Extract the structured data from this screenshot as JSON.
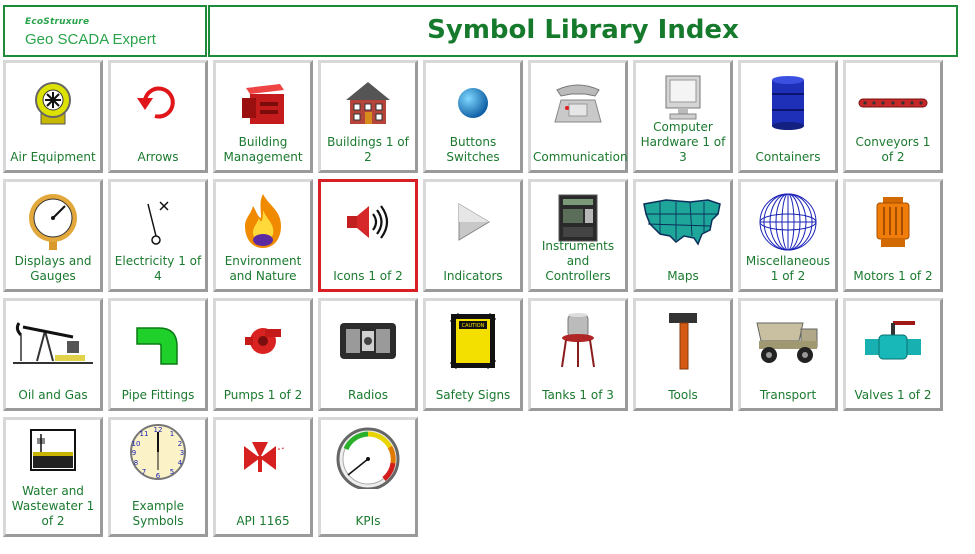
{
  "header": {
    "brand_top": "EcoStruxure",
    "brand_bottom": "Geo SCADA Expert",
    "title": "Symbol Library Index"
  },
  "colors": {
    "accent_green": "#1b7a2f",
    "selection_red": "#d71f25"
  },
  "tiles": [
    {
      "label": "Air Equipment",
      "icon": "fan-blower-icon"
    },
    {
      "label": "Arrows",
      "icon": "circular-arrow-icon"
    },
    {
      "label": "Building Management",
      "icon": "hvac-unit-icon"
    },
    {
      "label": "Buildings 1 of 2",
      "icon": "brick-house-icon"
    },
    {
      "label": "Buttons Switches",
      "icon": "round-button-icon"
    },
    {
      "label": "Communication",
      "icon": "telephone-icon"
    },
    {
      "label": "Computer Hardware 1 of 3",
      "icon": "computer-monitor-icon"
    },
    {
      "label": "Containers",
      "icon": "barrel-icon"
    },
    {
      "label": "Conveyors 1 of 2",
      "icon": "conveyor-icon"
    },
    {
      "label": "Displays and Gauges",
      "icon": "pressure-gauge-icon"
    },
    {
      "label": "Electricity 1 of 4",
      "icon": "switch-contact-icon"
    },
    {
      "label": "Environment and Nature",
      "icon": "fire-icon"
    },
    {
      "label": "Icons 1 of 2",
      "icon": "speaker-icon"
    },
    {
      "label": "Indicators",
      "icon": "triangle-indicator-icon"
    },
    {
      "label": "Instruments and Controllers",
      "icon": "controller-board-icon"
    },
    {
      "label": "Maps",
      "icon": "usa-map-icon"
    },
    {
      "label": "Miscellaneous 1 of 2",
      "icon": "wire-globe-icon"
    },
    {
      "label": "Motors 1 of 2",
      "icon": "motor-icon"
    },
    {
      "label": "Oil and Gas",
      "icon": "pumpjack-icon"
    },
    {
      "label": "Pipe Fittings",
      "icon": "pipe-elbow-icon"
    },
    {
      "label": "Pumps 1 of 2",
      "icon": "pump-icon"
    },
    {
      "label": "Radios",
      "icon": "radio-icon"
    },
    {
      "label": "Safety Signs",
      "icon": "caution-sign-icon"
    },
    {
      "label": "Tanks 1 of 3",
      "icon": "water-tank-icon"
    },
    {
      "label": "Tools",
      "icon": "hammer-icon"
    },
    {
      "label": "Transport",
      "icon": "dump-truck-icon"
    },
    {
      "label": "Valves 1 of 2",
      "icon": "valve-icon"
    },
    {
      "label": "Water and Wastewater 1 of 2",
      "icon": "wastewater-tank-icon"
    },
    {
      "label": "Example Symbols",
      "icon": "clock-icon"
    },
    {
      "label": "API 1165",
      "icon": "api-valve-icon"
    },
    {
      "label": "KPIs",
      "icon": "kpi-gauge-icon"
    }
  ],
  "selected_tile": "Icons 1 of 2"
}
